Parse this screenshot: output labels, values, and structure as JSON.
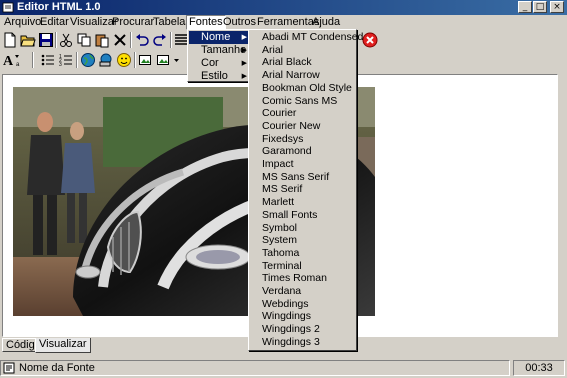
{
  "window": {
    "title": "Editor HTML 1.0",
    "controls": [
      "_",
      "□",
      "×"
    ]
  },
  "menu": [
    "Arquivo",
    "Editar",
    "Visualizar",
    "Procurar",
    "Tabelas",
    "Fontes",
    "Outros",
    "Ferramentas",
    "Ajuda"
  ],
  "fontes_submenu": [
    "Nome",
    "Tamanho",
    "Cor",
    "Estilo"
  ],
  "font_names": [
    "Abadi MT Condensed",
    "Arial",
    "Arial Black",
    "Arial Narrow",
    "Bookman Old  Style",
    "Comic Sans MS",
    "Courier",
    "Courier New",
    "Fixedsys",
    "Garamond",
    "Impact",
    "MS Sans Serif",
    "MS Serif",
    "Marlett",
    "Small Fonts",
    "Symbol",
    "System",
    "Tahoma",
    "Terminal",
    "Times Roman",
    "Verdana",
    "Webdings",
    "Wingdings",
    "Wingdings 2",
    "Wingdings 3"
  ],
  "tabs": [
    "Código",
    "Visualizar"
  ],
  "status": {
    "text": "Nome da Fonte",
    "time": "00:33"
  },
  "colors": {
    "title_start": "#0a246a",
    "title_end": "#3a6ea5",
    "highlight": "#0a246a",
    "stop": "#e02020"
  },
  "icons": {
    "toolbar1": [
      "new-icon",
      "open-icon",
      "save-icon",
      "cut-icon",
      "copy-icon",
      "paste-icon",
      "delete-icon",
      "undo-icon",
      "redo-icon",
      "align-icon",
      "stop-icon"
    ],
    "toolbar2": [
      "font-size-icon",
      "bullet-list-icon",
      "numbered-list-icon",
      "globe-icon",
      "link-icon",
      "smiley-icon",
      "image-icon",
      "image-dropdown-icon"
    ]
  }
}
